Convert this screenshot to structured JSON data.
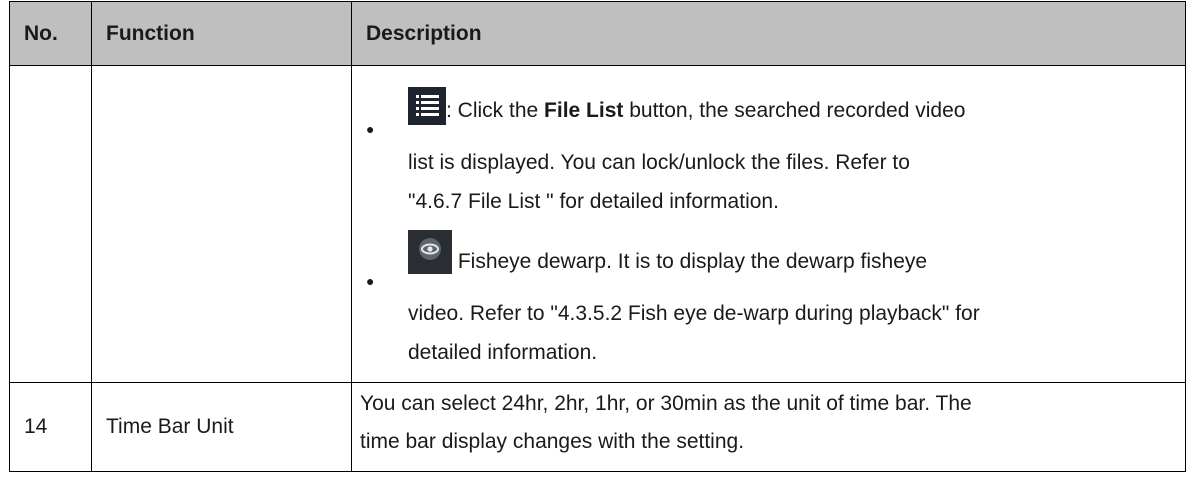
{
  "table": {
    "headers": {
      "no": "No.",
      "function": "Function",
      "description": "Description"
    },
    "row1": {
      "no": "",
      "function": "",
      "bullet1": {
        "icon": "file-list-icon",
        "prefix": ": Click the ",
        "bold": "File List",
        "suffix": " button, the searched recorded video",
        "line2": "list is displayed. You can lock/unlock the files. Refer to",
        "line3": "\"4.6.7 File List \" for detailed information."
      },
      "bullet2": {
        "icon": "fisheye-dewarp-icon",
        "line1": " Fisheye dewarp. It is to display the dewarp fisheye",
        "line2": "video. Refer to \"4.3.5.2 Fish eye de-warp during playback\" for",
        "line3": "detailed information."
      }
    },
    "row2": {
      "no": "14",
      "function": "Time Bar Unit",
      "line1": "You can select 24hr, 2hr, 1hr, or 30min as the unit of time bar. The",
      "line2": "time bar display changes with the setting."
    }
  },
  "bullet_char": "●",
  "colors": {
    "header_bg": "#bfbfbf",
    "border": "#000000",
    "icon_bg": "#1e2530"
  }
}
